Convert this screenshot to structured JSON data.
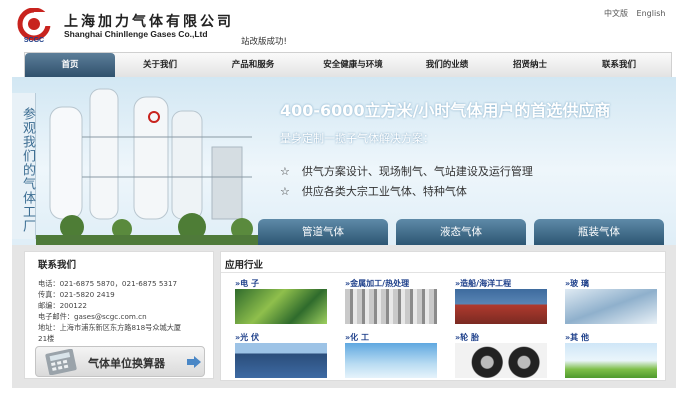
{
  "header": {
    "logo_text": "SCGC",
    "company_cn": "上海加力气体有限公司",
    "company_en": "Shanghai Chinllenge Gases Co.,Ltd",
    "notice": "站改版成功!",
    "languages": [
      "中文版",
      "English"
    ]
  },
  "nav": {
    "items": [
      "首页",
      "关于我们",
      "产品和服务",
      "安全健康与环境",
      "我们的业绩",
      "招贤纳士",
      "联系我们"
    ],
    "active_index": 0
  },
  "banner": {
    "side_tab": "参观我们的气体工厂",
    "headline": "400-6000立方米/小时气体用户的首选供应商",
    "subheadline": "量身定制一揽子气体解决方案：",
    "bullets": [
      "供气方案设计、现场制气、气站建设及运行管理",
      "供应各类大宗工业气体、特种气体"
    ],
    "bullet_symbol": "☆",
    "buttons": [
      "管道气体",
      "液态气体",
      "瓶装气体"
    ]
  },
  "contact": {
    "title": "联系我们",
    "lines": [
      "电话：021-6875 5870，021-6875 5317",
      "传真：021-5820 2419",
      "邮编：200122",
      "电子邮件：gases@scgc.com.cn",
      "地址：上海市浦东新区东方路818号众城大厦",
      "21楼"
    ],
    "calculator_label": "气体单位换算器"
  },
  "industries": {
    "title": "应用行业",
    "items": [
      {
        "label": "»电  子",
        "icon": "circuit-board-thumb"
      },
      {
        "label": "»金属加工/热处理",
        "icon": "steel-pipes-thumb"
      },
      {
        "label": "»造船/海洋工程",
        "icon": "shipyard-thumb"
      },
      {
        "label": "»玻  璃",
        "icon": "glass-facade-thumb"
      },
      {
        "label": "»光  伏",
        "icon": "solar-panels-thumb"
      },
      {
        "label": "»化  工",
        "icon": "chemical-plant-thumb"
      },
      {
        "label": "»轮  胎",
        "icon": "tyres-thumb"
      },
      {
        "label": "»其  他",
        "icon": "leaves-thumb"
      }
    ]
  },
  "colors": {
    "nav_active": "#3a5d7a",
    "accent_blue": "#1d3f8a",
    "logo_red": "#c8231e"
  }
}
